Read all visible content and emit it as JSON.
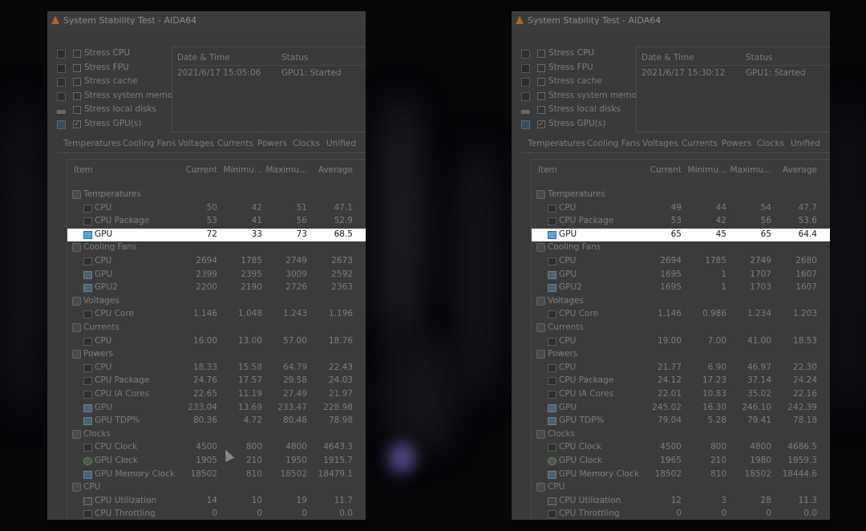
{
  "windows": [
    {
      "title": "System Stability Test - AIDA64",
      "options": [
        {
          "label": "Stress CPU",
          "checked": false
        },
        {
          "label": "Stress FPU",
          "checked": false
        },
        {
          "label": "Stress cache",
          "checked": false
        },
        {
          "label": "Stress system memory",
          "checked": false
        },
        {
          "label": "Stress local disks",
          "checked": false
        },
        {
          "label": "Stress GPU(s)",
          "checked": true
        }
      ],
      "log": {
        "col1": "Date & Time",
        "col2": "Status",
        "datetime": "2021/6/17 15:05:06",
        "status": "GPU1: Started"
      },
      "tabs": [
        "Temperatures",
        "Cooling Fans",
        "Voltages",
        "Currents",
        "Powers",
        "Clocks",
        "Unified"
      ],
      "headers": {
        "item": "Item",
        "current": "Current",
        "minimum": "Minimu...",
        "maximum": "Maximu...",
        "average": "Average"
      },
      "rows": [
        {
          "type": "cat",
          "name": "Temperatures",
          "icon": "thermometer-icon"
        },
        {
          "type": "item",
          "name": "CPU",
          "icon": "chip-icon",
          "cur": "50",
          "min": "42",
          "max": "51",
          "avg": "47.1"
        },
        {
          "type": "item",
          "name": "CPU Package",
          "icon": "chip-icon",
          "cur": "53",
          "min": "41",
          "max": "56",
          "avg": "52.9"
        },
        {
          "type": "item",
          "name": "GPU",
          "icon": "gpu-icon",
          "cur": "72",
          "min": "33",
          "max": "73",
          "avg": "68.5",
          "highlight": true
        },
        {
          "type": "cat",
          "name": "Cooling Fans",
          "icon": "fan-icon"
        },
        {
          "type": "item",
          "name": "CPU",
          "icon": "chip-icon",
          "cur": "2694",
          "min": "1785",
          "max": "2749",
          "avg": "2673"
        },
        {
          "type": "item",
          "name": "GPU",
          "icon": "gpu-icon",
          "cur": "2399",
          "min": "2395",
          "max": "3009",
          "avg": "2592"
        },
        {
          "type": "item",
          "name": "GPU2",
          "icon": "gpu-icon",
          "cur": "2200",
          "min": "2190",
          "max": "2726",
          "avg": "2363"
        },
        {
          "type": "cat",
          "name": "Voltages",
          "icon": "voltage-icon"
        },
        {
          "type": "item",
          "name": "CPU Core",
          "icon": "chip-icon",
          "cur": "1.146",
          "min": "1.048",
          "max": "1.243",
          "avg": "1.196"
        },
        {
          "type": "cat",
          "name": "Currents",
          "icon": "current-icon"
        },
        {
          "type": "item",
          "name": "CPU",
          "icon": "chip-icon",
          "cur": "16.00",
          "min": "13.00",
          "max": "57.00",
          "avg": "18.76"
        },
        {
          "type": "cat",
          "name": "Powers",
          "icon": "power-icon"
        },
        {
          "type": "item",
          "name": "CPU",
          "icon": "chip-icon",
          "cur": "18.33",
          "min": "15.58",
          "max": "64.79",
          "avg": "22.43"
        },
        {
          "type": "item",
          "name": "CPU Package",
          "icon": "chip-icon",
          "cur": "24.76",
          "min": "17.57",
          "max": "29.58",
          "avg": "24.03"
        },
        {
          "type": "item",
          "name": "CPU IA Cores",
          "icon": "chip-icon",
          "cur": "22.65",
          "min": "11.19",
          "max": "27.49",
          "avg": "21.97"
        },
        {
          "type": "item",
          "name": "GPU",
          "icon": "gpu-icon",
          "cur": "233.04",
          "min": "13.69",
          "max": "233.47",
          "avg": "228.98"
        },
        {
          "type": "item",
          "name": "GPU TDP%",
          "icon": "gpu-icon",
          "cur": "80.36",
          "min": "4.72",
          "max": "80.48",
          "avg": "78.98"
        },
        {
          "type": "cat",
          "name": "Clocks",
          "icon": "clock-icon"
        },
        {
          "type": "item",
          "name": "CPU Clock",
          "icon": "chip-icon",
          "cur": "4500",
          "min": "800",
          "max": "4800",
          "avg": "4643.3"
        },
        {
          "type": "item",
          "name": "GPU Clock",
          "icon": "clock-icon",
          "cur": "1905",
          "min": "210",
          "max": "1950",
          "avg": "1915.7"
        },
        {
          "type": "item",
          "name": "GPU Memory Clock",
          "icon": "gpu-icon",
          "cur": "18502",
          "min": "810",
          "max": "18502",
          "avg": "18479.1"
        },
        {
          "type": "cat",
          "name": "CPU",
          "icon": "chip-icon"
        },
        {
          "type": "item",
          "name": "CPU Utilization",
          "icon": "hourglass-icon",
          "cur": "14",
          "min": "10",
          "max": "19",
          "avg": "11.7"
        },
        {
          "type": "item",
          "name": "CPU Throttling",
          "icon": "chip-icon",
          "cur": "0",
          "min": "0",
          "max": "0",
          "avg": "0.0"
        }
      ]
    },
    {
      "title": "System Stability Test - AIDA64",
      "options": [
        {
          "label": "Stress CPU",
          "checked": false
        },
        {
          "label": "Stress FPU",
          "checked": false
        },
        {
          "label": "Stress cache",
          "checked": false
        },
        {
          "label": "Stress system memory",
          "checked": false
        },
        {
          "label": "Stress local disks",
          "checked": false
        },
        {
          "label": "Stress GPU(s)",
          "checked": true
        }
      ],
      "log": {
        "col1": "Date & Time",
        "col2": "Status",
        "datetime": "2021/6/17 15:30:12",
        "status": "GPU1: Started"
      },
      "tabs": [
        "Temperatures",
        "Cooling Fans",
        "Voltages",
        "Currents",
        "Powers",
        "Clocks",
        "Unified"
      ],
      "headers": {
        "item": "Item",
        "current": "Current",
        "minimum": "Minimu...",
        "maximum": "Maximu...",
        "average": "Average"
      },
      "rows": [
        {
          "type": "cat",
          "name": "Temperatures",
          "icon": "thermometer-icon"
        },
        {
          "type": "item",
          "name": "CPU",
          "icon": "chip-icon",
          "cur": "49",
          "min": "44",
          "max": "54",
          "avg": "47.7"
        },
        {
          "type": "item",
          "name": "CPU Package",
          "icon": "chip-icon",
          "cur": "53",
          "min": "42",
          "max": "56",
          "avg": "53.6"
        },
        {
          "type": "item",
          "name": "GPU",
          "icon": "gpu-icon",
          "cur": "65",
          "min": "45",
          "max": "65",
          "avg": "64.4",
          "highlight": true
        },
        {
          "type": "cat",
          "name": "Cooling Fans",
          "icon": "fan-icon"
        },
        {
          "type": "item",
          "name": "CPU",
          "icon": "chip-icon",
          "cur": "2694",
          "min": "1785",
          "max": "2749",
          "avg": "2680"
        },
        {
          "type": "item",
          "name": "GPU",
          "icon": "gpu-icon",
          "cur": "1695",
          "min": "1",
          "max": "1707",
          "avg": "1607"
        },
        {
          "type": "item",
          "name": "GPU2",
          "icon": "gpu-icon",
          "cur": "1695",
          "min": "1",
          "max": "1703",
          "avg": "1607"
        },
        {
          "type": "cat",
          "name": "Voltages",
          "icon": "voltage-icon"
        },
        {
          "type": "item",
          "name": "CPU Core",
          "icon": "chip-icon",
          "cur": "1.146",
          "min": "0.986",
          "max": "1.234",
          "avg": "1.203"
        },
        {
          "type": "cat",
          "name": "Currents",
          "icon": "current-icon"
        },
        {
          "type": "item",
          "name": "CPU",
          "icon": "chip-icon",
          "cur": "19.00",
          "min": "7.00",
          "max": "41.00",
          "avg": "18.53"
        },
        {
          "type": "cat",
          "name": "Powers",
          "icon": "power-icon"
        },
        {
          "type": "item",
          "name": "CPU",
          "icon": "chip-icon",
          "cur": "21.77",
          "min": "6.90",
          "max": "46.97",
          "avg": "22.30"
        },
        {
          "type": "item",
          "name": "CPU Package",
          "icon": "chip-icon",
          "cur": "24.12",
          "min": "17.23",
          "max": "37.14",
          "avg": "24.24"
        },
        {
          "type": "item",
          "name": "CPU IA Cores",
          "icon": "chip-icon",
          "cur": "22.01",
          "min": "10.83",
          "max": "35.02",
          "avg": "22.16"
        },
        {
          "type": "item",
          "name": "GPU",
          "icon": "gpu-icon",
          "cur": "245.02",
          "min": "16.30",
          "max": "246.10",
          "avg": "242.39"
        },
        {
          "type": "item",
          "name": "GPU TDP%",
          "icon": "gpu-icon",
          "cur": "79.04",
          "min": "5.28",
          "max": "79.41",
          "avg": "78.18"
        },
        {
          "type": "cat",
          "name": "Clocks",
          "icon": "clock-icon"
        },
        {
          "type": "item",
          "name": "CPU Clock",
          "icon": "chip-icon",
          "cur": "4500",
          "min": "800",
          "max": "4800",
          "avg": "4686.5"
        },
        {
          "type": "item",
          "name": "GPU Clock",
          "icon": "clock-icon",
          "cur": "1965",
          "min": "210",
          "max": "1980",
          "avg": "1959.3"
        },
        {
          "type": "item",
          "name": "GPU Memory Clock",
          "icon": "gpu-icon",
          "cur": "18502",
          "min": "810",
          "max": "18502",
          "avg": "18444.6"
        },
        {
          "type": "cat",
          "name": "CPU",
          "icon": "chip-icon"
        },
        {
          "type": "item",
          "name": "CPU Utilization",
          "icon": "hourglass-icon",
          "cur": "12",
          "min": "3",
          "max": "28",
          "avg": "11.3"
        },
        {
          "type": "item",
          "name": "CPU Throttling",
          "icon": "chip-icon",
          "cur": "0",
          "min": "0",
          "max": "0",
          "avg": "0.0"
        }
      ]
    }
  ],
  "colors": {
    "highlight_bg": "#ffffff",
    "window_bg": "#3a3a3a",
    "text": "#7e7e7e"
  }
}
